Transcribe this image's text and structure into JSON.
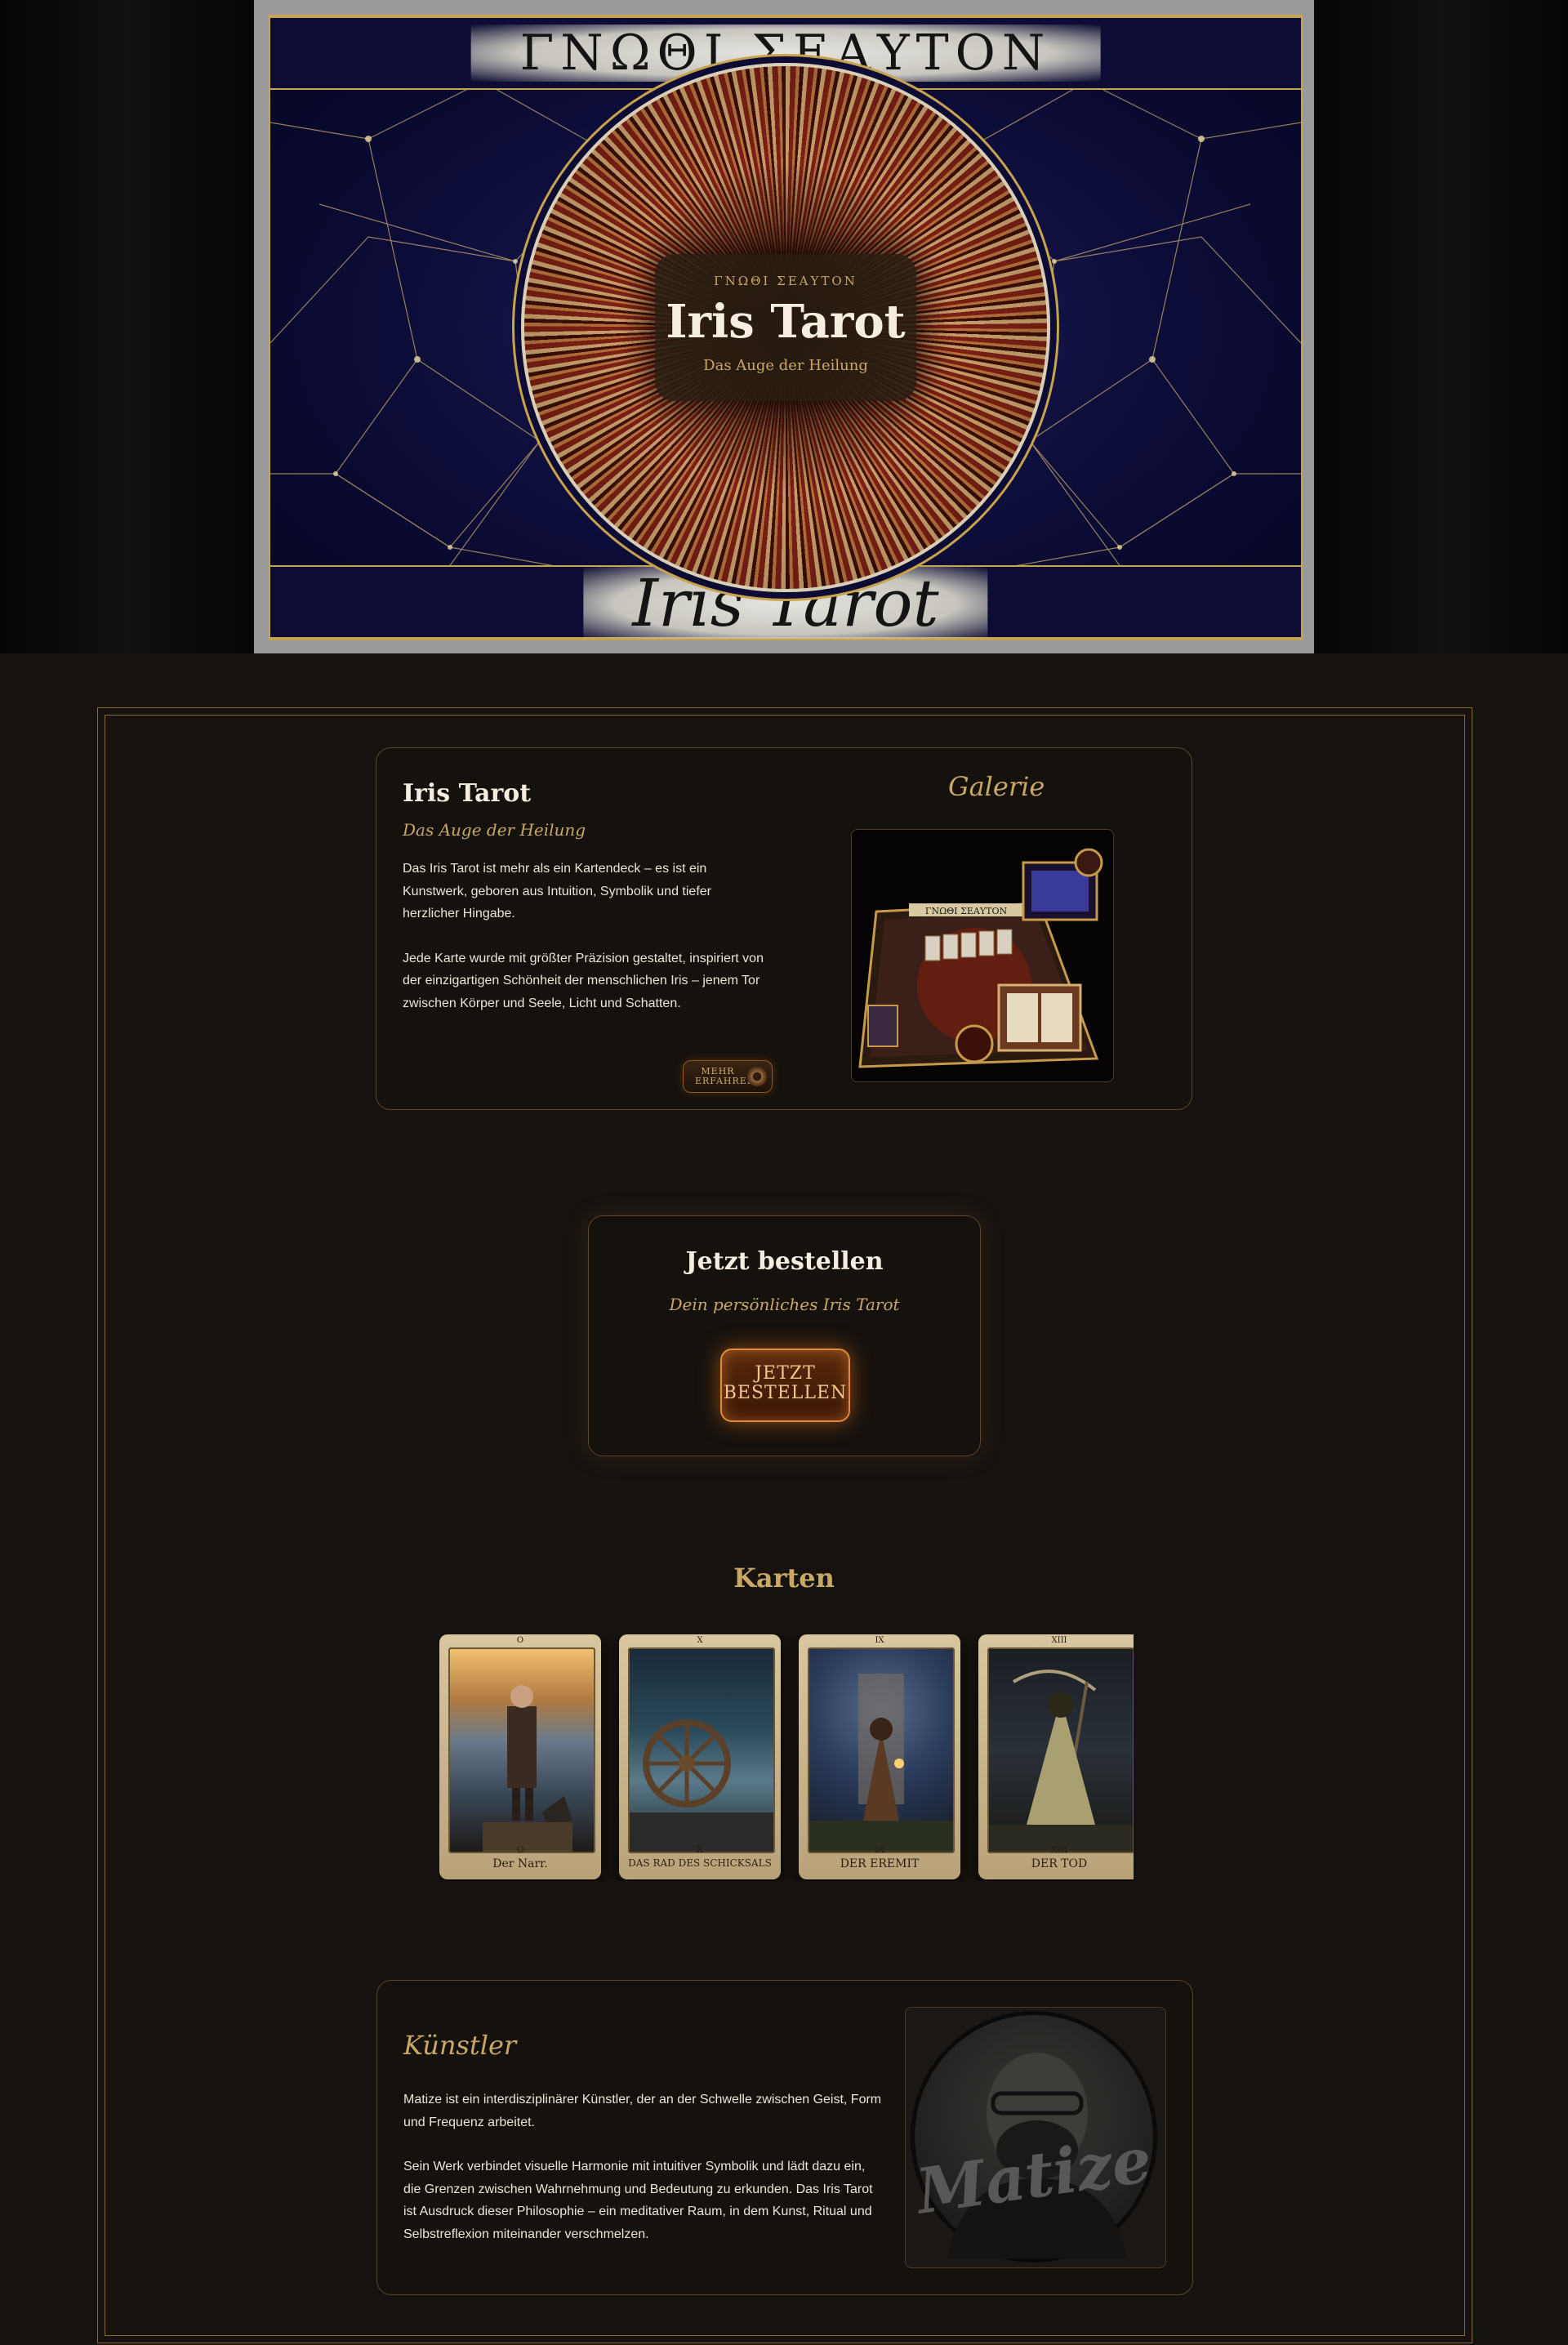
{
  "hero": {
    "band_top": "ΓΝΩΘΙ ΣΕΑΥΤΟΝ",
    "band_bottom": "Iris Tarot",
    "plaque_kicker": "ΓΝΩΘΙ ΣΕΑΥΤΟΝ",
    "plaque_title": "Iris Tarot",
    "plaque_subtitle": "Das Auge der Heilung"
  },
  "about": {
    "title": "Iris Tarot",
    "subtitle": "Das Auge der Heilung",
    "paragraphs": [
      "Das Iris Tarot ist mehr als ein Kartendeck – es ist ein Kunstwerk, geboren aus Intuition, Symbolik und tiefer herzlicher Hingabe.",
      "Jede Karte wurde mit größter Präzision gestaltet, inspiriert von der einzigartigen Schönheit der menschlichen Iris – jenem Tor zwischen Körper und Seele, Licht und Schatten."
    ],
    "more_button": "MEHR ERFAHREN",
    "gallery_title": "Galerie",
    "gallery_plate": "ΓΝΩΘΙ ΣΕΑΥΤΟΝ"
  },
  "order": {
    "title": "Jetzt bestellen",
    "subtitle": "Dein persönliches Iris Tarot",
    "button": "JETZT BESTELLEN"
  },
  "cards": {
    "title": "Karten",
    "items": [
      {
        "numeral": "O",
        "name": "Der Narr."
      },
      {
        "numeral": "X",
        "name": "DAS RAD DES SCHICKSALS"
      },
      {
        "numeral": "IX",
        "name": "DER EREMIT"
      },
      {
        "numeral": "XIII",
        "name": "DER TOD"
      }
    ]
  },
  "artist": {
    "title": "Künstler",
    "paragraphs": [
      "Matize ist ein interdisziplinärer Künstler, der an der Schwelle zwischen Geist, Form und Frequenz arbeitet.",
      "Sein Werk verbindet visuelle Harmonie mit intuitiver Symbolik und lädt dazu ein, die Grenzen zwischen Wahrnehmung und Bedeutung zu erkunden. Das Iris Tarot ist Ausdruck dieser Philosophie – ein meditativer Raum, in dem Kunst, Ritual und Selbstreflexion miteinander verschmelzen."
    ],
    "signature": "Matize"
  },
  "colors": {
    "background": "#16120f",
    "gold": "#c9a866",
    "frame": "#8a6a32",
    "text": "#ece5d7",
    "accent_orange": "#e08a3a"
  }
}
